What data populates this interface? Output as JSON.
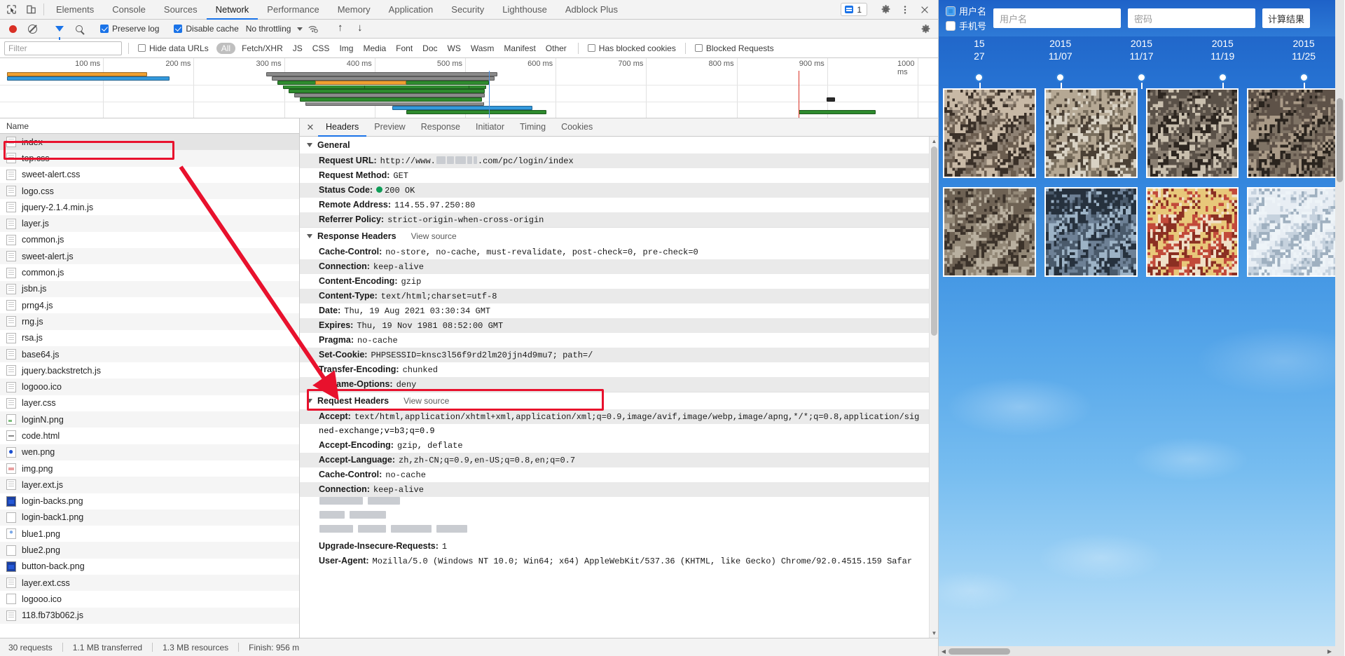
{
  "devtools": {
    "tabs": [
      {
        "label": "Elements",
        "selected": false
      },
      {
        "label": "Console",
        "selected": false
      },
      {
        "label": "Sources",
        "selected": false
      },
      {
        "label": "Network",
        "selected": true
      },
      {
        "label": "Performance",
        "selected": false
      },
      {
        "label": "Memory",
        "selected": false
      },
      {
        "label": "Application",
        "selected": false
      },
      {
        "label": "Security",
        "selected": false
      },
      {
        "label": "Lighthouse",
        "selected": false
      },
      {
        "label": "Adblock Plus",
        "selected": false
      }
    ],
    "message_count": "1",
    "network_toolbar": {
      "preserve_log_label": "Preserve log",
      "preserve_log_checked": true,
      "disable_cache_label": "Disable cache",
      "disable_cache_checked": true,
      "throttling_value": "No throttling"
    },
    "filter_bar": {
      "filter_placeholder": "Filter",
      "hide_data_urls_label": "Hide data URLs",
      "hide_data_urls_checked": false,
      "types": [
        "All",
        "Fetch/XHR",
        "JS",
        "CSS",
        "Img",
        "Media",
        "Font",
        "Doc",
        "WS",
        "Wasm",
        "Manifest",
        "Other"
      ],
      "selected_type": "All",
      "has_blocked_cookies_label": "Has blocked cookies",
      "has_blocked_cookies_checked": false,
      "blocked_requests_label": "Blocked Requests",
      "blocked_requests_checked": false
    },
    "overview": {
      "ticks": [
        "100 ms",
        "200 ms",
        "300 ms",
        "400 ms",
        "500 ms",
        "600 ms",
        "700 ms",
        "800 ms",
        "900 ms",
        "1000 ms"
      ]
    },
    "requests_header": "Name",
    "requests": [
      {
        "name": "index",
        "icon": "doc",
        "selected": true
      },
      {
        "name": "top.css",
        "icon": "doc",
        "selected": false
      },
      {
        "name": "sweet-alert.css",
        "icon": "doc",
        "selected": false
      },
      {
        "name": "logo.css",
        "icon": "doc",
        "selected": false
      },
      {
        "name": "jquery-2.1.4.min.js",
        "icon": "doc",
        "selected": false
      },
      {
        "name": "layer.js",
        "icon": "doc",
        "selected": false
      },
      {
        "name": "common.js",
        "icon": "doc",
        "selected": false
      },
      {
        "name": "sweet-alert.js",
        "icon": "doc",
        "selected": false
      },
      {
        "name": "common.js",
        "icon": "doc",
        "selected": false
      },
      {
        "name": "jsbn.js",
        "icon": "doc",
        "selected": false
      },
      {
        "name": "prng4.js",
        "icon": "doc",
        "selected": false
      },
      {
        "name": "rng.js",
        "icon": "doc",
        "selected": false
      },
      {
        "name": "rsa.js",
        "icon": "doc",
        "selected": false
      },
      {
        "name": "base64.js",
        "icon": "doc",
        "selected": false
      },
      {
        "name": "jquery.backstretch.js",
        "icon": "doc",
        "selected": false
      },
      {
        "name": "logooo.ico",
        "icon": "doc",
        "selected": false
      },
      {
        "name": "layer.css",
        "icon": "doc",
        "selected": false
      },
      {
        "name": "loginN.png",
        "icon": "img-green",
        "selected": false
      },
      {
        "name": "code.html",
        "icon": "html",
        "selected": false
      },
      {
        "name": "wen.png",
        "icon": "img-q",
        "selected": false
      },
      {
        "name": "img.png",
        "icon": "img-pink",
        "selected": false
      },
      {
        "name": "layer.ext.js",
        "icon": "doc",
        "selected": false
      },
      {
        "name": "login-backs.png",
        "icon": "img-blue",
        "selected": false
      },
      {
        "name": "login-back1.png",
        "icon": "blank",
        "selected": false
      },
      {
        "name": "blue1.png",
        "icon": "img-dot",
        "selected": false
      },
      {
        "name": "blue2.png",
        "icon": "blank",
        "selected": false
      },
      {
        "name": "button-back.png",
        "icon": "img-blue",
        "selected": false
      },
      {
        "name": "layer.ext.css",
        "icon": "doc",
        "selected": false
      },
      {
        "name": "logooo.ico",
        "icon": "blank",
        "selected": false
      },
      {
        "name": "118.fb73b062.js",
        "icon": "doc",
        "selected": false
      }
    ],
    "detail_tabs": [
      {
        "label": "Headers",
        "selected": true
      },
      {
        "label": "Preview",
        "selected": false
      },
      {
        "label": "Response",
        "selected": false
      },
      {
        "label": "Initiator",
        "selected": false
      },
      {
        "label": "Timing",
        "selected": false
      },
      {
        "label": "Cookies",
        "selected": false
      }
    ],
    "sections": {
      "general_title": "General",
      "response_title": "Response Headers",
      "request_title": "Request Headers",
      "view_source_label": "View source"
    },
    "general": [
      {
        "key": "Request URL:",
        "value": "http://www.██████.com/pc/login/index",
        "redacted": true
      },
      {
        "key": "Request Method:",
        "value": "GET"
      },
      {
        "key": "Status Code:",
        "value": "200 OK",
        "status_ok": true
      },
      {
        "key": "Remote Address:",
        "value": "114.55.97.250:80"
      },
      {
        "key": "Referrer Policy:",
        "value": "strict-origin-when-cross-origin"
      }
    ],
    "response_headers": [
      {
        "key": "Cache-Control:",
        "value": "no-store, no-cache, must-revalidate, post-check=0, pre-check=0"
      },
      {
        "key": "Connection:",
        "value": "keep-alive"
      },
      {
        "key": "Content-Encoding:",
        "value": "gzip"
      },
      {
        "key": "Content-Type:",
        "value": "text/html;charset=utf-8"
      },
      {
        "key": "Date:",
        "value": "Thu, 19 Aug 2021 03:30:34 GMT"
      },
      {
        "key": "Expires:",
        "value": "Thu, 19 Nov 1981 08:52:00 GMT"
      },
      {
        "key": "Pragma:",
        "value": "no-cache"
      },
      {
        "key": "Set-Cookie:",
        "value": "PHPSESSID=knsc3l56f9rd2lm20jjn4d9mu7; path=/",
        "highlighted": true
      },
      {
        "key": "Transfer-Encoding:",
        "value": "chunked"
      },
      {
        "key": "X-Frame-Options:",
        "value": "deny"
      }
    ],
    "request_headers": [
      {
        "key": "Accept:",
        "value": "text/html,application/xhtml+xml,application/xml;q=0.9,image/avif,image/webp,image/apng,*/*;q=0.8,application/sig",
        "cont": "ned-exchange;v=b3;q=0.9"
      },
      {
        "key": "Accept-Encoding:",
        "value": "gzip, deflate"
      },
      {
        "key": "Accept-Language:",
        "value": "zh,zh-CN;q=0.9,en-US;q=0.8,en;q=0.7"
      },
      {
        "key": "Cache-Control:",
        "value": "no-cache"
      },
      {
        "key": "Connection:",
        "value": "keep-alive"
      },
      {
        "key": "Upgrade-Insecure-Requests:",
        "value": "1"
      },
      {
        "key": "User-Agent:",
        "value": "Mozilla/5.0 (Windows NT 10.0; Win64; x64) AppleWebKit/537.36 (KHTML, like Gecko) Chrome/92.0.4515.159 Safar"
      }
    ],
    "status_bar": {
      "requests": "30 requests",
      "transferred": "1.1 MB transferred",
      "resources": "1.3 MB resources",
      "finish": "Finish: 956 m"
    },
    "accent_color": "#1a73e8",
    "annotation_color": "#e8112d"
  },
  "browser": {
    "login": {
      "radio_username": "用户名",
      "radio_phone": "手机号",
      "radio_selected": "用户名",
      "username_placeholder": "用户名",
      "password_placeholder": "密码",
      "calc_button": "计算结果"
    },
    "dates": [
      {
        "top": "15",
        "bottom": "27"
      },
      {
        "top": "2015",
        "bottom": "11/07"
      },
      {
        "top": "2015",
        "bottom": "11/17"
      },
      {
        "top": "2015",
        "bottom": "11/19"
      },
      {
        "top": "2015",
        "bottom": "11/25"
      }
    ]
  }
}
